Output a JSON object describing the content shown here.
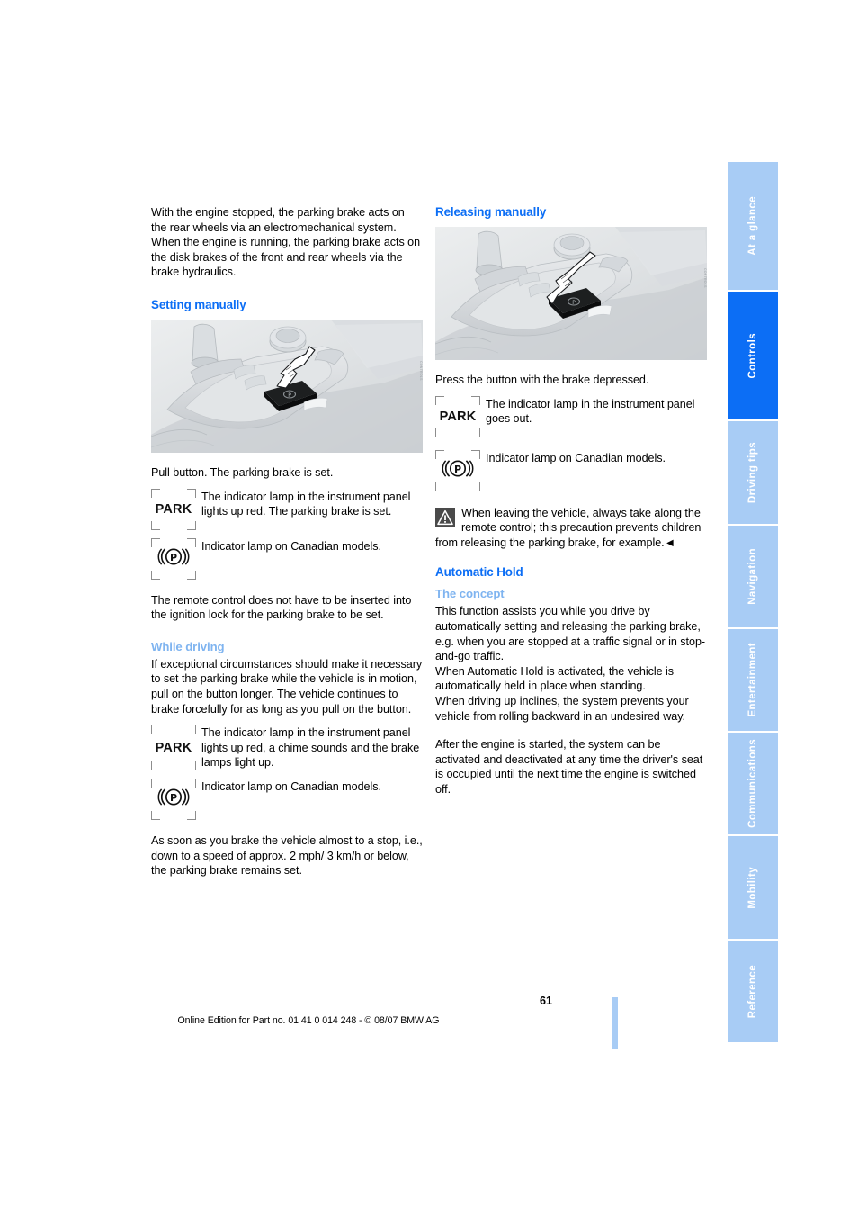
{
  "document": {
    "page_number": "61",
    "footer_text": "Online Edition for Part no. 01 41 0 014 248 - © 08/07 BMW AG"
  },
  "side_tabs": [
    {
      "label": "At a glance",
      "active": false
    },
    {
      "label": "Controls",
      "active": true
    },
    {
      "label": "Driving tips",
      "active": false
    },
    {
      "label": "Navigation",
      "active": false
    },
    {
      "label": "Entertainment",
      "active": false
    },
    {
      "label": "Communications",
      "active": false
    },
    {
      "label": "Mobility",
      "active": false
    },
    {
      "label": "Reference",
      "active": false
    }
  ],
  "colors": {
    "heading_blue": "#0c6ef5",
    "subheading_blue": "#7fb4f0",
    "tab_inactive": "#a8ccf5",
    "tab_active": "#0c6ef5"
  },
  "left_column": {
    "intro": "With the engine stopped, the parking brake acts on the rear wheels via an electromechanical system. When the engine is running, the parking brake acts on the disk brakes of the front and rear wheels via the brake hydraulics.",
    "setting_manually": {
      "heading": "Setting manually",
      "image_credit": "CONTROLS",
      "caption": "Pull button. The parking brake is set.",
      "lamps": [
        {
          "glyph": "PARK",
          "text": "The indicator lamp in the instrument panel lights up red. The parking brake is set."
        },
        {
          "glyph": "((P))",
          "text": "Indicator lamp on Canadian models."
        }
      ],
      "note": "The remote control does not have to be inserted into the ignition lock for the parking brake to be set."
    },
    "while_driving": {
      "heading": "While driving",
      "body": "If exceptional circumstances should make it necessary to set the parking brake while the vehicle is in motion, pull on the button longer. The vehicle continues to brake forcefully for as long as you pull on the button.",
      "lamps": [
        {
          "glyph": "PARK",
          "text": "The indicator lamp in the instrument panel lights up red, a chime sounds and the brake lamps light up."
        },
        {
          "glyph": "((P))",
          "text": "Indicator lamp on Canadian models."
        }
      ],
      "closing": "As soon as you brake the vehicle almost to a stop, i.e., down to a speed of approx. 2 mph/ 3 km/h or below, the parking brake remains set."
    }
  },
  "right_column": {
    "releasing_manually": {
      "heading": "Releasing manually",
      "image_credit": "CONTROLS",
      "caption": "Press the button with the brake depressed.",
      "lamps": [
        {
          "glyph": "PARK",
          "text": "The indicator lamp  in the instrument panel goes out."
        },
        {
          "glyph": "((P))",
          "text": "Indicator lamp on Canadian models."
        }
      ],
      "warning": "When leaving the vehicle, always take along the remote control; this precaution prevents children from releasing the parking brake, for example.◄"
    },
    "automatic_hold": {
      "heading": "Automatic Hold",
      "subheading": "The concept",
      "paragraph_1": "This function assists you while you drive by automatically setting and releasing the parking brake, e.g. when you are stopped at a traffic signal or in stop-and-go traffic.",
      "paragraph_2": "When Automatic Hold is activated, the vehicle is automatically held in place when standing.",
      "paragraph_3": "When driving up inclines, the system prevents your vehicle from rolling backward in an undesired way.",
      "paragraph_4": "After the engine is started, the system can be activated and deactivated at any time the driver's seat is occupied until the next time the engine is switched off."
    }
  }
}
